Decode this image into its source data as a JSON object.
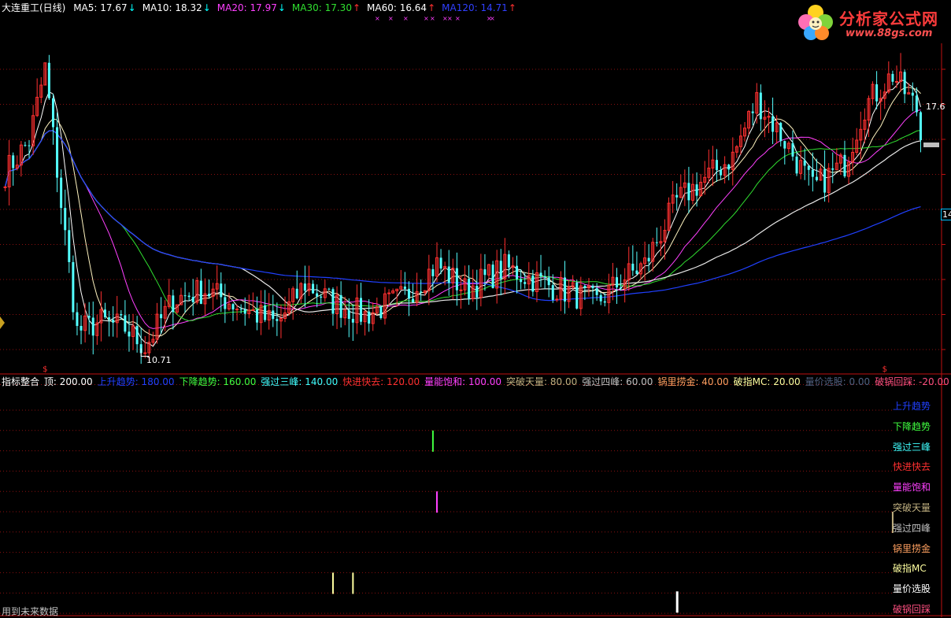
{
  "main_header": {
    "stock": "大连重工(日线)",
    "ma": [
      {
        "label": "MA5: 17.67",
        "arrow": "↓",
        "color": "#ffffff",
        "arrow_color": "#00ffff"
      },
      {
        "label": "MA10: 18.32",
        "arrow": "↓",
        "color": "#ffffff",
        "arrow_color": "#00ffff"
      },
      {
        "label": "MA20: 17.97",
        "arrow": "↓",
        "color": "#ff40ff",
        "arrow_color": "#00ffff"
      },
      {
        "label": "MA30: 17.30",
        "arrow": "↑",
        "color": "#30e030",
        "arrow_color": "#ff3030"
      },
      {
        "label": "MA60: 16.64",
        "arrow": "↑",
        "color": "#ffffff",
        "arrow_color": "#ff3030"
      },
      {
        "label": "MA120: 14.71",
        "arrow": "↑",
        "color": "#3040ff",
        "arrow_color": "#ff3030"
      }
    ]
  },
  "indicator_header": {
    "name": "指标整合",
    "items": [
      {
        "label": "顶: 200.00",
        "color": "#ffffff"
      },
      {
        "label": "上升趋势: 180.00",
        "color": "#2040ff"
      },
      {
        "label": "下降趋势: 160.00",
        "color": "#40ff40"
      },
      {
        "label": "强过三峰: 140.00",
        "color": "#40ffff"
      },
      {
        "label": "快进快去: 120.00",
        "color": "#ff3030"
      },
      {
        "label": "量能饱和: 100.00",
        "color": "#ff40ff"
      },
      {
        "label": "突破天量: 80.00",
        "color": "#c0b080"
      },
      {
        "label": "强过四峰: 60.00",
        "color": "#c0c0c0"
      },
      {
        "label": "锅里捞金: 40.00",
        "color": "#ffa060"
      },
      {
        "label": "破指MC: 20.00",
        "color": "#ffffa0"
      },
      {
        "label": "量价选股: 0.00",
        "color": "#506080"
      },
      {
        "label": "破锅回踩: -20.00",
        "color": "#ff5080"
      }
    ]
  },
  "indicator_labels": [
    {
      "label": "上升趋势",
      "color": "#2040ff"
    },
    {
      "label": "下降趋势",
      "color": "#40ff40"
    },
    {
      "label": "强过三峰",
      "color": "#40ffff"
    },
    {
      "label": "快进快去",
      "color": "#ff3030"
    },
    {
      "label": "量能饱和",
      "color": "#ff40ff"
    },
    {
      "label": "突破天量",
      "color": "#c0b080"
    },
    {
      "label": "强过四峰",
      "color": "#c0c0c0"
    },
    {
      "label": "锅里捞金",
      "color": "#ffa060"
    },
    {
      "label": "破指MC",
      "color": "#ffffa0"
    },
    {
      "label": "量价选股",
      "color": "#ffffff"
    },
    {
      "label": "破锅回踩",
      "color": "#ff5080"
    }
  ],
  "footer_note": "用到未来数据",
  "logo": {
    "title": "分析家公式网",
    "url": "www.88gs.com"
  },
  "price_labels": {
    "low": "10.71",
    "current": "17.6",
    "right_axis": "14"
  },
  "chart_data": {
    "type": "candlestick",
    "y_range": [
      10.2,
      21.5
    ],
    "x_count": 230,
    "current_price": 17.6,
    "low_marker": {
      "index": 34,
      "value": 10.71
    },
    "signals": {
      "下降趋势": [
        107
      ],
      "量能饱和": [
        108
      ],
      "突破天量": [
        222
      ],
      "破指MC": [
        82,
        87
      ],
      "量价选股": [
        168
      ]
    },
    "ma120_end": 14.71
  },
  "colors": {
    "up": "#ff3030",
    "down": "#54ffff",
    "grid": "#8a1010",
    "axis": "#c01010"
  }
}
